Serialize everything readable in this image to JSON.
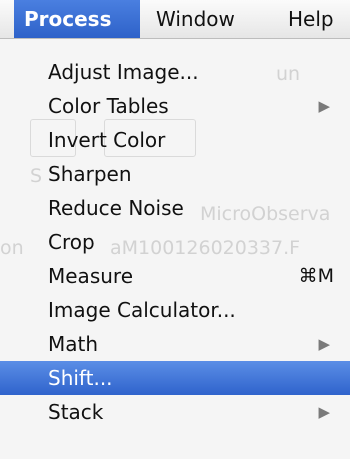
{
  "menubar": {
    "items": [
      {
        "label": "Process",
        "active": true
      },
      {
        "label": "Window",
        "active": false
      },
      {
        "label": "Help",
        "active": false
      }
    ]
  },
  "menu": {
    "items": [
      {
        "label": "Adjust Image..."
      },
      {
        "label": "Color Tables",
        "submenu_icon": "chevron-right-icon",
        "arrow": "▶"
      },
      {
        "label": "Invert Color"
      },
      {
        "label": "Sharpen"
      },
      {
        "label": "Reduce Noise"
      },
      {
        "label": "Crop"
      },
      {
        "label": "Measure",
        "shortcut": "⌘M"
      },
      {
        "label": "Image Calculator..."
      },
      {
        "label": "Math",
        "submenu_icon": "chevron-right-icon",
        "arrow": "▶"
      },
      {
        "label": "Shift...",
        "highlighted": true
      },
      {
        "label": "Stack",
        "submenu_icon": "chevron-right-icon",
        "arrow": "▶"
      }
    ]
  },
  "background_ghost": {
    "line1": "un",
    "line2": "S",
    "line3": "MicroObserva",
    "line4": "on",
    "line5": "aM100126020337.F"
  },
  "colors": {
    "highlight": "#3a6fd8",
    "menu_bg": "#f5f5f5"
  }
}
